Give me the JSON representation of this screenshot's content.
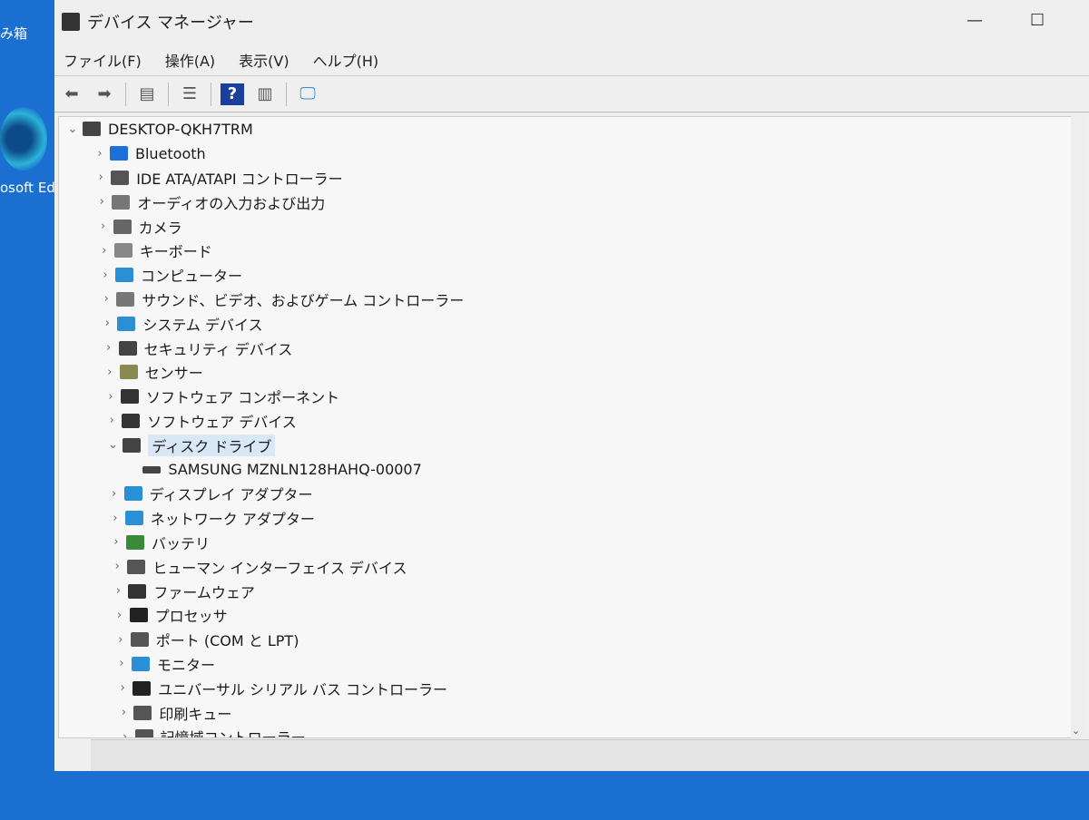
{
  "desktop": {
    "recycle_label": "み箱",
    "edge_label": "osoft Ed"
  },
  "window": {
    "title": "デバイス マネージャー",
    "minimize": "—",
    "maximize": "☐"
  },
  "menu": [
    "ファイル(F)",
    "操作(A)",
    "表示(V)",
    "ヘルプ(H)"
  ],
  "toolbar": [
    "back-icon",
    "forward-icon",
    "properties-pane-icon",
    "list-icon",
    "help-icon",
    "action-pane-icon",
    "scan-hardware-icon"
  ],
  "tree": {
    "root": "DESKTOP-QKH7TRM",
    "items": [
      {
        "label": "Bluetooth",
        "icon": "bluetooth-icon",
        "color": "#1e6fd9"
      },
      {
        "label": "IDE ATA/ATAPI コントローラー",
        "icon": "ide-icon",
        "color": "#555555"
      },
      {
        "label": "オーディオの入力および出力",
        "icon": "speaker-icon",
        "color": "#777777"
      },
      {
        "label": "カメラ",
        "icon": "camera-icon",
        "color": "#666666"
      },
      {
        "label": "キーボード",
        "icon": "keyboard-icon",
        "color": "#888888"
      },
      {
        "label": "コンピューター",
        "icon": "computer-icon",
        "color": "#2b8fd6"
      },
      {
        "label": "サウンド、ビデオ、およびゲーム コントローラー",
        "icon": "sound-icon",
        "color": "#777777"
      },
      {
        "label": "システム デバイス",
        "icon": "system-icon",
        "color": "#2b8fd6"
      },
      {
        "label": "セキュリティ デバイス",
        "icon": "security-icon",
        "color": "#444444"
      },
      {
        "label": "センサー",
        "icon": "sensor-icon",
        "color": "#8a8a50"
      },
      {
        "label": "ソフトウェア コンポーネント",
        "icon": "software-component-icon",
        "color": "#333333"
      },
      {
        "label": "ソフトウェア デバイス",
        "icon": "software-device-icon",
        "color": "#333333"
      },
      {
        "label": "ディスク ドライブ",
        "icon": "disk-icon",
        "color": "#444444",
        "expanded": true,
        "selected": true,
        "children": [
          "SAMSUNG MZNLN128HAHQ-00007"
        ]
      },
      {
        "label": "ディスプレイ アダプター",
        "icon": "display-icon",
        "color": "#2b8fd6"
      },
      {
        "label": "ネットワーク アダプター",
        "icon": "network-icon",
        "color": "#2b8fd6"
      },
      {
        "label": "バッテリ",
        "icon": "battery-icon",
        "color": "#3a8a3a"
      },
      {
        "label": "ヒューマン インターフェイス デバイス",
        "icon": "hid-icon",
        "color": "#555555"
      },
      {
        "label": "ファームウェア",
        "icon": "firmware-icon",
        "color": "#333333"
      },
      {
        "label": "プロセッサ",
        "icon": "processor-icon",
        "color": "#222222"
      },
      {
        "label": "ポート (COM と LPT)",
        "icon": "port-icon",
        "color": "#555555"
      },
      {
        "label": "モニター",
        "icon": "monitor-icon",
        "color": "#2b8fd6"
      },
      {
        "label": "ユニバーサル シリアル バス コントローラー",
        "icon": "usb-icon",
        "color": "#222222"
      },
      {
        "label": "印刷キュー",
        "icon": "printer-icon",
        "color": "#555555"
      },
      {
        "label": "記憶域コントローラー",
        "icon": "storage-icon",
        "color": "#555555"
      }
    ]
  }
}
